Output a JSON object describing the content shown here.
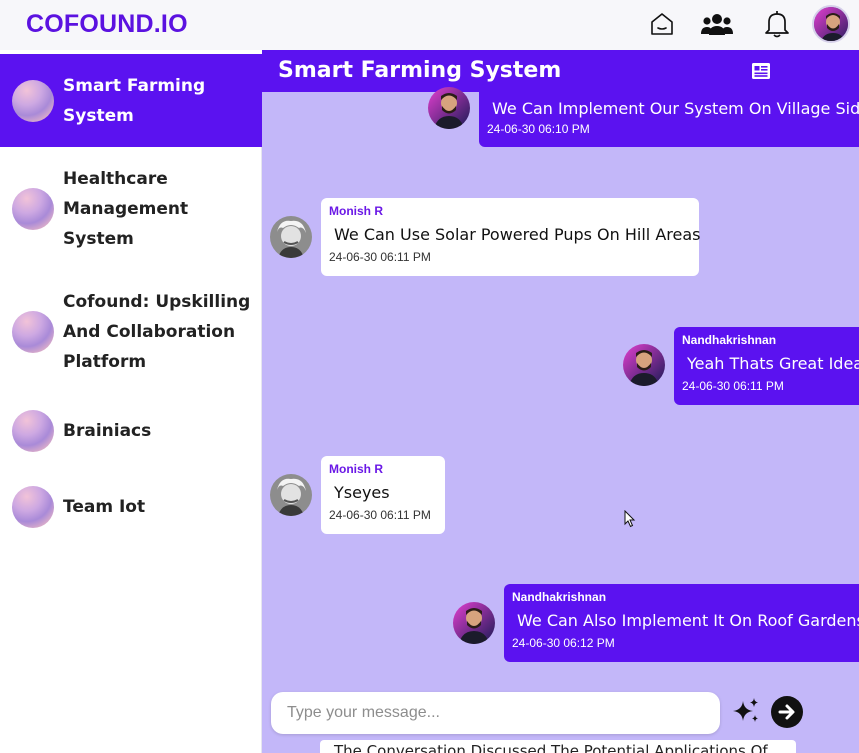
{
  "brand": "COFOUND.IO",
  "topbar_icons": [
    "home-icon",
    "team-icon",
    "bell-icon",
    "profile-avatar"
  ],
  "sidebar": {
    "groups": [
      {
        "label": "Smart Farming System",
        "active": true
      },
      {
        "label": "Healthcare Management System",
        "active": false
      },
      {
        "label": "Cofound: Upskilling And Collaboration Platform",
        "active": false
      },
      {
        "label": "Brainiacs",
        "active": false
      },
      {
        "label": "Team Iot",
        "active": false
      }
    ]
  },
  "chat": {
    "title": "Smart Farming System",
    "messages": [
      {
        "side": "me",
        "sender": "",
        "text": "We Can Implement Our System On Village Side",
        "time": "24-06-30 06:10 PM"
      },
      {
        "side": "them",
        "sender": "Monish R",
        "text": "We Can Use Solar Powered Pups On Hill Areas",
        "time": "24-06-30 06:11 PM"
      },
      {
        "side": "me",
        "sender": "Nandhakrishnan",
        "text": "Yeah Thats Great Idea",
        "time": "24-06-30 06:11 PM"
      },
      {
        "side": "them",
        "sender": "Monish R",
        "text": "Yseyes",
        "time": "24-06-30 06:11 PM"
      },
      {
        "side": "me",
        "sender": "Nandhakrishnan",
        "text": "We Can Also Implement It On Roof Gardens",
        "time": "24-06-30 06:12 PM"
      }
    ],
    "input_placeholder": "Type your message...",
    "summary_text": "The Conversation Discussed The Potential Applications Of"
  },
  "colors": {
    "accent": "#5b12f0",
    "chat_bg": "#c3b7f9",
    "brand": "#5b12e0"
  }
}
